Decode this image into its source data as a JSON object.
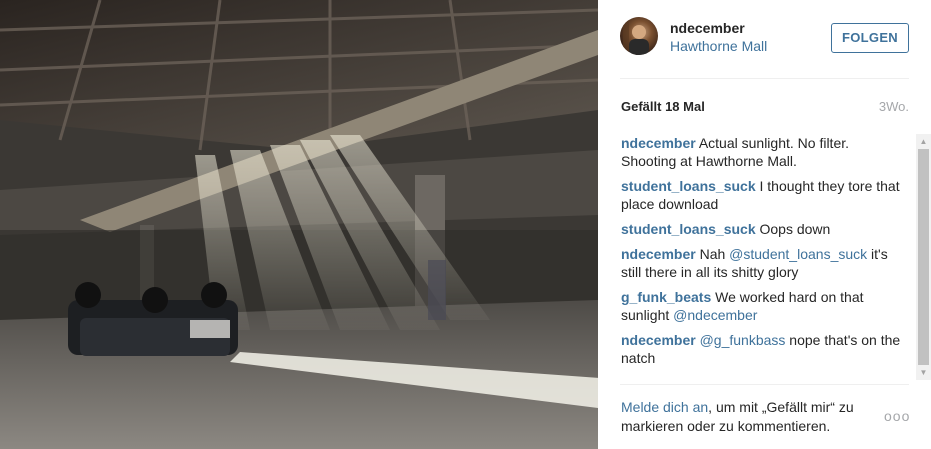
{
  "post": {
    "username": "ndecember",
    "location": "Hawthorne Mall",
    "follow_label": "FOLGEN",
    "likes": "Gefällt 18 Mal",
    "time": "3Wo."
  },
  "comments": [
    {
      "author": "ndecember",
      "parts": [
        {
          "text": " Actual sunlight. No filter. Shooting at Hawthorne Mall.",
          "mention": false
        }
      ]
    },
    {
      "author": "student_loans_suck",
      "parts": [
        {
          "text": " I thought they tore that place download",
          "mention": false
        }
      ]
    },
    {
      "author": "student_loans_suck",
      "parts": [
        {
          "text": " Oops down",
          "mention": false
        }
      ]
    },
    {
      "author": "ndecember",
      "parts": [
        {
          "text": " Nah ",
          "mention": false
        },
        {
          "text": "@student_loans_suck",
          "mention": true
        },
        {
          "text": " it's still there in all its shitty glory",
          "mention": false
        }
      ]
    },
    {
      "author": "g_funk_beats",
      "parts": [
        {
          "text": " We worked hard on that sunlight ",
          "mention": false
        },
        {
          "text": "@ndecember",
          "mention": true
        }
      ]
    },
    {
      "author": "ndecember",
      "parts": [
        {
          "text": " ",
          "mention": false
        },
        {
          "text": "@g_funkbass",
          "mention": true
        },
        {
          "text": " nope that's on the natch",
          "mention": false
        }
      ]
    }
  ],
  "footer": {
    "login_link": "Melde dich an",
    "login_rest": ", um mit „Gefällt mir“ zu markieren oder zu kommentieren.",
    "more_label": "ooo"
  },
  "icons": {
    "more": "more-options-icon",
    "scroll_up": "scroll-up-icon",
    "scroll_down": "scroll-down-icon"
  },
  "colors": {
    "link": "#3f729b",
    "text": "#262626",
    "muted": "#a5a7aa"
  }
}
